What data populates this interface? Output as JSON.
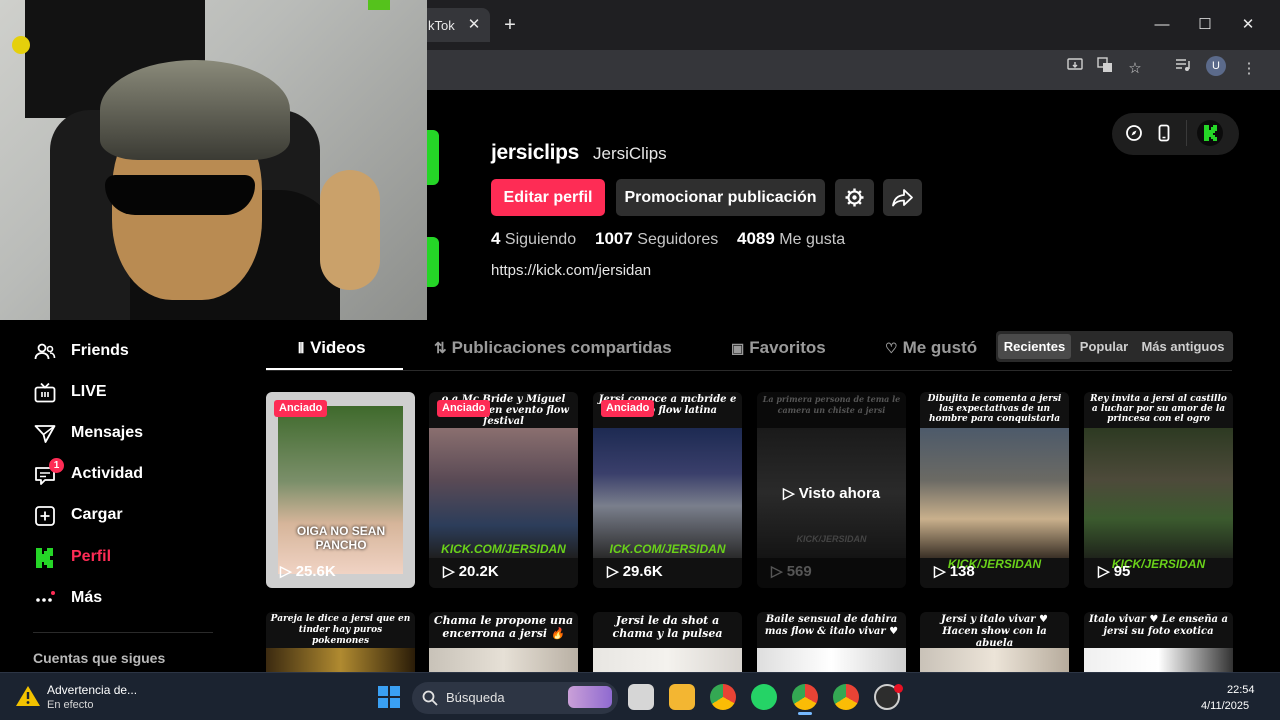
{
  "browser": {
    "tab_title": "kTok",
    "tab_close": "✕",
    "new_tab": "+",
    "window_minimize": "—",
    "window_maximize": "☐",
    "window_close": "✕",
    "profile_initial": "U"
  },
  "profile": {
    "username": "jersiclips",
    "nickname": "JersiClips",
    "edit_button": "Editar perfil",
    "promote_button": "Promocionar publicación",
    "following_count": "4",
    "following_label": "Siguiendo",
    "followers_count": "1007",
    "followers_label": "Seguidores",
    "likes_count": "4089",
    "likes_label": "Me gusta",
    "link": "https://kick.com/jersidan"
  },
  "sidebar": {
    "items": [
      {
        "label": "Friends",
        "icon": "friends-icon"
      },
      {
        "label": "LIVE",
        "icon": "live-tv-icon"
      },
      {
        "label": "Mensajes",
        "icon": "send-icon"
      },
      {
        "label": "Actividad",
        "icon": "activity-icon",
        "badge": "1"
      },
      {
        "label": "Cargar",
        "icon": "upload-icon"
      },
      {
        "label": "Perfil",
        "icon": "kick-logo-icon",
        "active": true
      },
      {
        "label": "Más",
        "icon": "more-icon"
      }
    ],
    "following_title": "Cuentas que sigues"
  },
  "tabs": {
    "videos": "Videos",
    "reposts": "Publicaciones compartidas",
    "favorites": "Favoritos",
    "liked": "Me gustó"
  },
  "sort": {
    "recent": "Recientes",
    "popular": "Popular",
    "oldest": "Más antiguos"
  },
  "videos_row1": [
    {
      "caption": "",
      "pinned": "Anciado",
      "views": "25.6K",
      "overlay": "OIGA NO SEAN PANCHO"
    },
    {
      "caption": "o a Mc Bride y Miguel Miranda en evento flow festival",
      "pinned": "Anciado",
      "views": "20.2K",
      "watermark": "KICK.COM/JERSIDAN"
    },
    {
      "caption": "Jersi conoce a mcbride e evento flow latina",
      "pinned": "Anciado",
      "views": "29.6K",
      "watermark": "ICK.COM/JERSIDAN"
    },
    {
      "caption": "La primera persona de tema le camera un chiste a jersi",
      "views": "569",
      "watch_now": "Visto ahora",
      "watermark": "KICK/JERSIDAN"
    },
    {
      "caption": "Dibujita le comenta a jersi las expectativas de un hombre para conquistarla",
      "views": "138",
      "watermark": "KICK/JERSIDAN"
    },
    {
      "caption": "Rey invita a jersi al castillo a luchar por su amor de la princesa con el ogro",
      "views": "95",
      "watermark": "KICK/JERSIDAN"
    }
  ],
  "videos_row2": [
    {
      "caption": "Pareja le dice a jersi que en tinder hay puros pokemones"
    },
    {
      "caption": "Chama le propone una encerrona a jersi 🔥"
    },
    {
      "caption": "Jersi le da shot a chama y la pulsea"
    },
    {
      "caption": "Baile sensual de dahira mas flow & italo vivar ♥"
    },
    {
      "caption": "Jersi y italo vivar ♥ Hacen show con la abuela"
    },
    {
      "caption": "Italo vivar ♥ Le enseña a jersi su foto exotica"
    }
  ],
  "taskbar": {
    "warning_title": "Advertencia de...",
    "warning_subtitle": "En efecto",
    "search_placeholder": "Búsqueda",
    "time": "22:54",
    "date": "4/11/2025"
  },
  "colors": {
    "accent": "#fe2c55",
    "kick_green": "#25d627"
  }
}
